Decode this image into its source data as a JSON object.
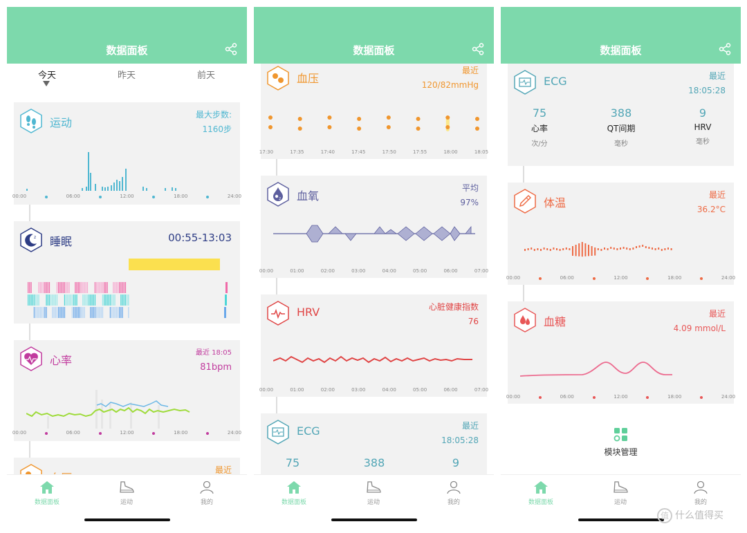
{
  "header_title": "数据面板",
  "date_tabs": [
    "今天",
    "昨天",
    "前天"
  ],
  "nav": [
    {
      "label": "数据面板",
      "icon": "home-icon"
    },
    {
      "label": "运动",
      "icon": "sneaker-icon"
    },
    {
      "label": "我的",
      "icon": "person-icon"
    }
  ],
  "axis_hours": [
    "00:00",
    "06:00",
    "12:00",
    "18:00",
    "24:00"
  ],
  "axis_night": [
    "00:00",
    "01:00",
    "02:00",
    "03:00",
    "04:00",
    "05:00",
    "06:00",
    "07:00"
  ],
  "axis_bp": [
    "17:30",
    "17:35",
    "17:40",
    "17:45",
    "17:50",
    "17:55",
    "18:00",
    "18:05"
  ],
  "cards": {
    "exercise": {
      "title": "运动",
      "label": "最大步数:",
      "value": "1160步",
      "color": "#4fb7d1"
    },
    "sleep": {
      "title": "睡眠",
      "value": "00:55-13:03",
      "color": "#2e3d85"
    },
    "heart": {
      "title": "心率",
      "label": "最近 18:05",
      "value": "81bpm",
      "color": "#c13b9e"
    },
    "bp": {
      "title": "血压",
      "label": "最近",
      "value": "120/82mmHg",
      "color": "#f0962e"
    },
    "spo2": {
      "title": "血氧",
      "label": "平均",
      "value": "97%",
      "color": "#5d5f9e"
    },
    "hrv": {
      "title": "HRV",
      "label": "心脏健康指数",
      "value": "76",
      "color": "#e04545"
    },
    "ecg": {
      "title": "ECG",
      "label": "最近",
      "value": "18:05:28",
      "color": "#52a6b6",
      "metrics": [
        {
          "value": "75",
          "label": "心率",
          "unit": "次/分"
        },
        {
          "value": "388",
          "label": "QT间期",
          "unit": "毫秒"
        },
        {
          "value": "9",
          "label": "HRV",
          "unit": "毫秒"
        }
      ]
    },
    "temp": {
      "title": "体温",
      "label": "最近",
      "value": "36.2°C",
      "color": "#ee6a44"
    },
    "glucose": {
      "title": "血糖",
      "label": "最近",
      "value": "4.09 mmol/L",
      "color": "#e85757"
    }
  },
  "module_manage": "模块管理",
  "watermark": "什么值得买",
  "watermark_glyph": "值"
}
